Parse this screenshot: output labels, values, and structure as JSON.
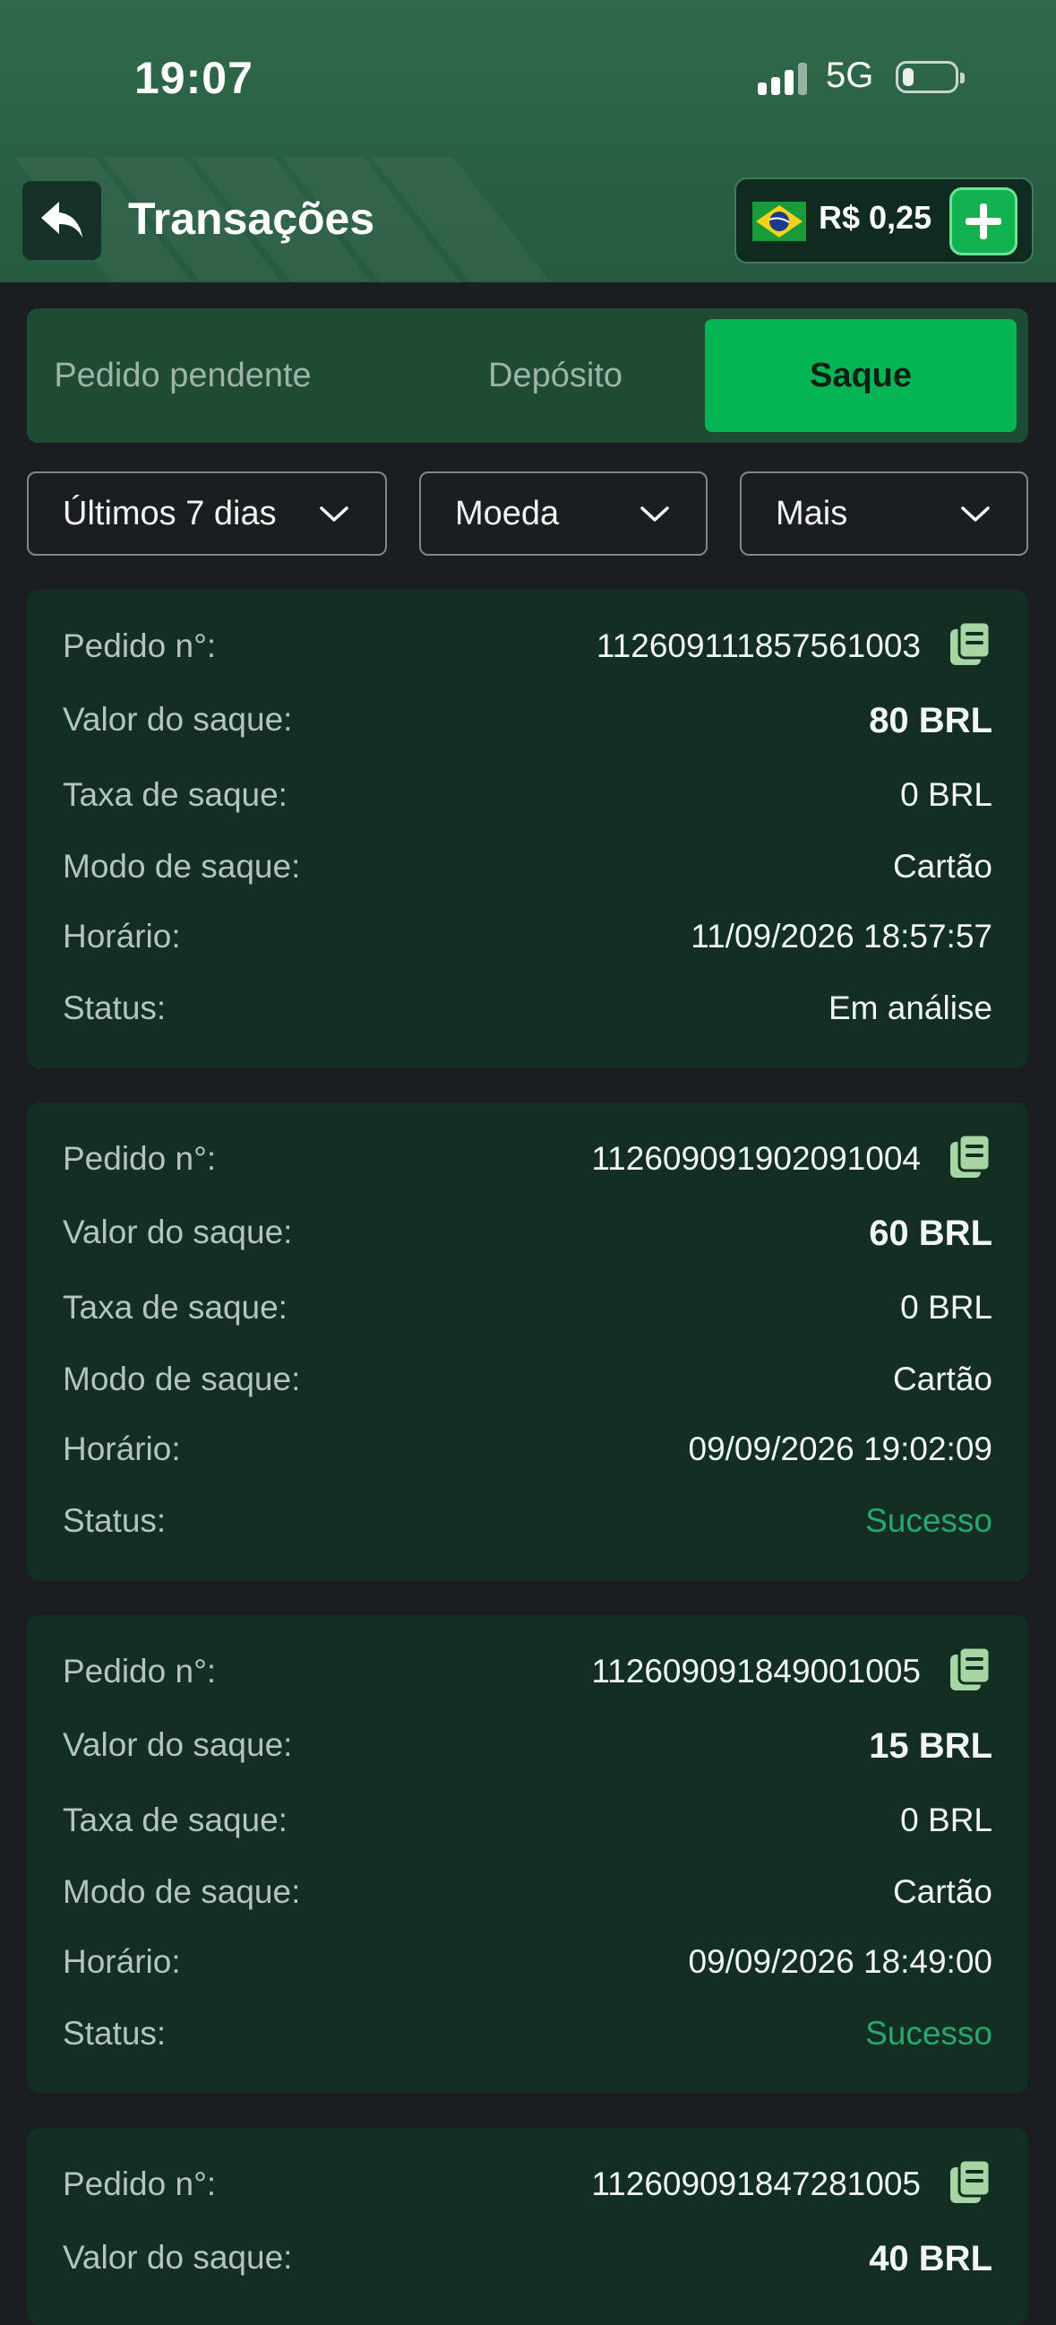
{
  "status_bar": {
    "time": "19:07",
    "network": "5G"
  },
  "header": {
    "title": "Transações",
    "balance": "R$ 0,25"
  },
  "tabs": [
    {
      "label": "Pedido pendente",
      "active": false
    },
    {
      "label": "Depósito",
      "active": false
    },
    {
      "label": "Saque",
      "active": true
    }
  ],
  "filters": {
    "period": "Últimos 7 dias",
    "currency": "Moeda",
    "more": "Mais"
  },
  "field_labels": {
    "order": "Pedido n°:",
    "amount": "Valor do saque:",
    "fee": "Taxa de saque:",
    "mode": "Modo de saque:",
    "time": "Horário:",
    "status": "Status:"
  },
  "transactions": [
    {
      "order": "112609111857561003",
      "amount": "80 BRL",
      "fee": "0 BRL",
      "mode": "Cartão",
      "time": "11/09/2026 18:57:57",
      "status": "Em análise"
    },
    {
      "order": "112609091902091004",
      "amount": "60 BRL",
      "fee": "0 BRL",
      "mode": "Cartão",
      "time": "09/09/2026 19:02:09",
      "status": "Sucesso"
    },
    {
      "order": "112609091849001005",
      "amount": "15 BRL",
      "fee": "0 BRL",
      "mode": "Cartão",
      "time": "09/09/2026 18:49:00",
      "status": "Sucesso"
    },
    {
      "order": "112609091847281005",
      "amount": "40 BRL"
    }
  ],
  "colors": {
    "accent": "#05b553",
    "success": "#26a96c",
    "card": "#132e22",
    "header": "#2a5f45"
  }
}
